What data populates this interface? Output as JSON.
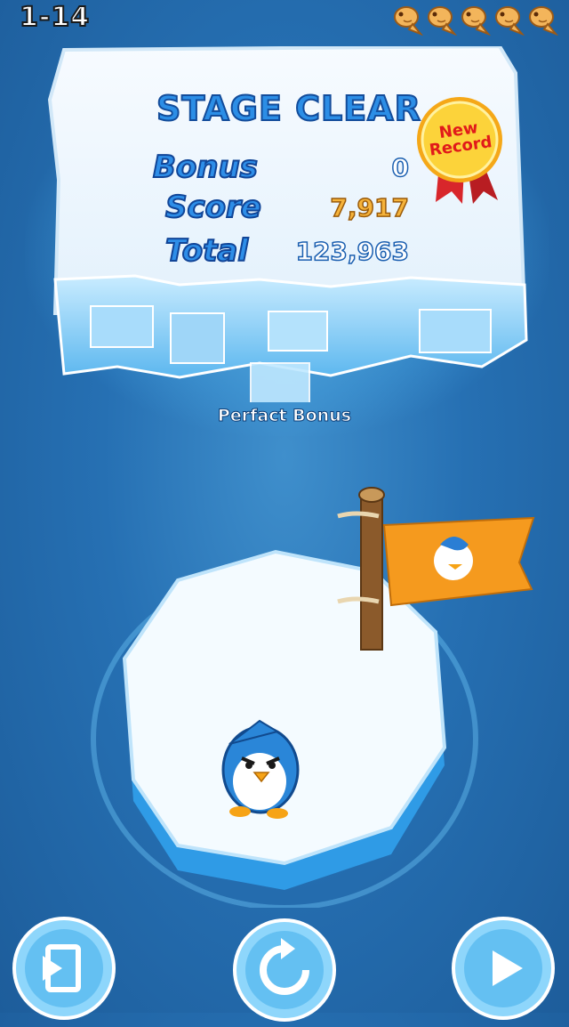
{
  "hud": {
    "level": "1-14",
    "fish_collected": 5,
    "fish_icons": [
      "fish-icon",
      "fish-icon",
      "fish-icon",
      "fish-icon",
      "fish-icon"
    ]
  },
  "result_panel": {
    "title": "STAGE CLEAR",
    "rows": [
      {
        "label": "Bonus",
        "value": "0"
      },
      {
        "label": "Score",
        "value": "7,917"
      },
      {
        "label": "Total",
        "value": "123,963"
      }
    ],
    "badge": {
      "line1": "New",
      "line2": "Record",
      "icon": "ribbon-medal-icon"
    },
    "perfect_bonus": "Perfact Bonus"
  },
  "buttons": {
    "back_icon": "exit-door-icon",
    "retry_icon": "replay-icon",
    "next_icon": "play-icon"
  },
  "colors": {
    "water": "#2670b3",
    "title_blue": "#2c8ee6",
    "score_orange": "#f6b33a",
    "flag_orange": "#f59a1e",
    "badge_gold": "#f8c21b",
    "ribbon_red": "#d8262b"
  }
}
